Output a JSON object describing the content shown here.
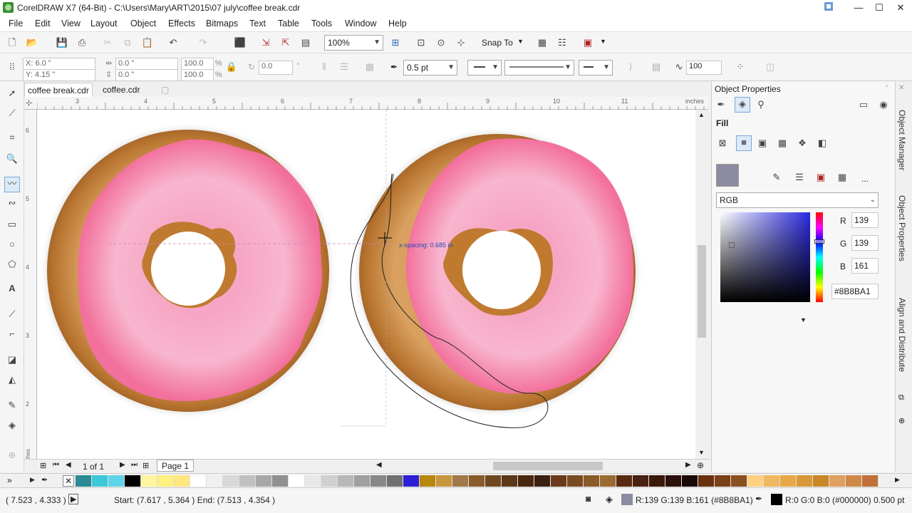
{
  "window": {
    "title": "CorelDRAW X7 (64-Bit) - C:\\Users\\Mary\\ART\\2015\\07 july\\coffee break.cdr"
  },
  "menu": [
    "File",
    "Edit",
    "View",
    "Layout",
    "Object",
    "Effects",
    "Bitmaps",
    "Text",
    "Table",
    "Tools",
    "Window",
    "Help"
  ],
  "standard_toolbar": {
    "zoom_value": "100%",
    "snap_to_label": "Snap To"
  },
  "property_bar": {
    "x_value": "X: 6.0 \"",
    "y_value": "Y: 4.15 \"",
    "width_value": "0.0 \"",
    "height_value": "0.0 \"",
    "scale_w": "100.0",
    "scale_h": "100.0",
    "percent": "%",
    "rotation_value": "0.0",
    "outline_width": "0.5 pt",
    "smoothing_value": "100"
  },
  "doc_tabs": [
    "coffee break.cdr",
    "coffee.cdr"
  ],
  "ruler": {
    "h_ticks": [
      "3",
      "4",
      "5",
      "6",
      "7",
      "8",
      "9",
      "10",
      "11"
    ],
    "h_unit": "inches",
    "v_ticks": [
      "6",
      "5",
      "4",
      "3",
      "2"
    ],
    "v_unit": "inches"
  },
  "canvas": {
    "spacing_label": "x-spacing: 0.685 in"
  },
  "page_nav": {
    "page_count": "1 of 1",
    "page_tab": "Page 1"
  },
  "status": {
    "cursor_coords": "( 7.523 , 4.333 )",
    "start_end": "Start: (7.617 , 5.364 )  End: (7.513 , 4.354 )",
    "fill_info": "R:139 G:139 B:161 (#8B8BA1)",
    "outline_info": "R:0 G:0 B:0 (#000000)  0.500 pt"
  },
  "docker": {
    "title": "Object Properties",
    "fill_header": "Fill",
    "color_model": "RGB",
    "r_label": "R",
    "g_label": "G",
    "b_label": "B",
    "r_value": "139",
    "g_value": "139",
    "b_value": "161",
    "hex_value": "#8B8BA1",
    "more_label": "..."
  },
  "docker_tabs": [
    "Object Manager",
    "Object Properties",
    "Align and Distribute"
  ],
  "colors": {
    "fill_color": "#8B8BA1",
    "donut_icing": "#f59bbd",
    "donut_dough": "#c98a3e"
  },
  "palette": [
    "#2a8a96",
    "#3cc8d8",
    "#5fd4e8",
    "#000000",
    "#fff5a0",
    "#fff080",
    "#ffe680",
    "#ffffff",
    "#f0f0f0",
    "#d8d8d8",
    "#c0c0c0",
    "#a8a8a8",
    "#909090",
    "#ffffff",
    "#e8e8e8",
    "#d0d0d0",
    "#b8b8b8",
    "#a0a0a0",
    "#888888",
    "#707070",
    "#2d1fd6",
    "#b8860b",
    "#c8963e",
    "#a0784a",
    "#8b5a2b",
    "#704820",
    "#5a3818",
    "#4a2810",
    "#3a2010",
    "#6b3a1a",
    "#7a4a20",
    "#8a5a28",
    "#9a6a30",
    "#5a2a10",
    "#4a2010",
    "#3a1808",
    "#2a1008",
    "#1a0804",
    "#6a3010",
    "#7a4018",
    "#8a5020",
    "#ffd080",
    "#f0b860",
    "#e8a848",
    "#d89838",
    "#c88828",
    "#e0a060",
    "#d08848",
    "#c07038"
  ]
}
